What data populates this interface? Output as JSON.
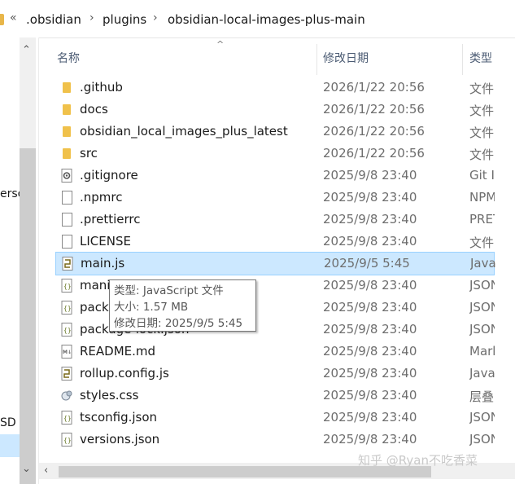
{
  "address_bar": {
    "overflow": "«",
    "path": [
      ".obsidian",
      "plugins",
      "obsidian-local-images-plus-main"
    ]
  },
  "left_pane": {
    "fragments": [
      "ersc",
      "SD ("
    ]
  },
  "columns": {
    "name": "名称",
    "date": "修改日期",
    "type": "类型"
  },
  "files": [
    {
      "name": ".github",
      "date": "2026/1/22 20:56",
      "type": "文件",
      "icon": "folder-icon"
    },
    {
      "name": "docs",
      "date": "2026/1/22 20:56",
      "type": "文件",
      "icon": "folder-icon"
    },
    {
      "name": "obsidian_local_images_plus_latest",
      "date": "2026/1/22 20:56",
      "type": "文件",
      "icon": "folder-icon"
    },
    {
      "name": "src",
      "date": "2026/1/22 20:56",
      "type": "文件",
      "icon": "folder-icon"
    },
    {
      "name": ".gitignore",
      "date": "2025/9/8 23:40",
      "type": "Git I",
      "icon": "gear-file-icon"
    },
    {
      "name": ".npmrc",
      "date": "2025/9/8 23:40",
      "type": "NPM",
      "icon": "blank-file-icon"
    },
    {
      "name": ".prettierrc",
      "date": "2025/9/8 23:40",
      "type": "PRET",
      "icon": "blank-file-icon"
    },
    {
      "name": "LICENSE",
      "date": "2025/9/8 23:40",
      "type": "文件",
      "icon": "blank-file-icon"
    },
    {
      "name": "main.js",
      "date": "2025/9/5 5:45",
      "type": "Java",
      "icon": "script-file-icon",
      "selected": true
    },
    {
      "name": "mani",
      "date": "2025/9/8 23:40",
      "type": "JSON",
      "icon": "json-file-icon"
    },
    {
      "name": "pack",
      "date": "2025/9/8 23:40",
      "type": "JSON",
      "icon": "json-file-icon"
    },
    {
      "name": "package-lock.json",
      "date": "2025/9/8 23:40",
      "type": "JSON",
      "icon": "json-file-icon"
    },
    {
      "name": "README.md",
      "date": "2025/9/8 23:40",
      "type": "Mark",
      "icon": "markdown-file-icon"
    },
    {
      "name": "rollup.config.js",
      "date": "2025/9/8 23:40",
      "type": "Java",
      "icon": "script-file-icon"
    },
    {
      "name": "styles.css",
      "date": "2025/9/8 23:40",
      "type": "层叠",
      "icon": "css-file-icon"
    },
    {
      "name": "tsconfig.json",
      "date": "2025/9/8 23:40",
      "type": "JSON",
      "icon": "json-file-icon"
    },
    {
      "name": "versions.json",
      "date": "2025/9/8 23:40",
      "type": "JSON",
      "icon": "json-file-icon"
    }
  ],
  "tooltip": {
    "type_line": "类型: JavaScript 文件",
    "size_line": "大小: 1.57 MB",
    "date_line": "修改日期: 2025/9/5 5:45"
  },
  "watermark": "知乎 @Ryan不吃香菜",
  "colors": {
    "selection_bg": "#cce8ff",
    "selection_border": "#99d1ff",
    "folder": "#f0c14b",
    "header_text": "#4b5b73"
  }
}
